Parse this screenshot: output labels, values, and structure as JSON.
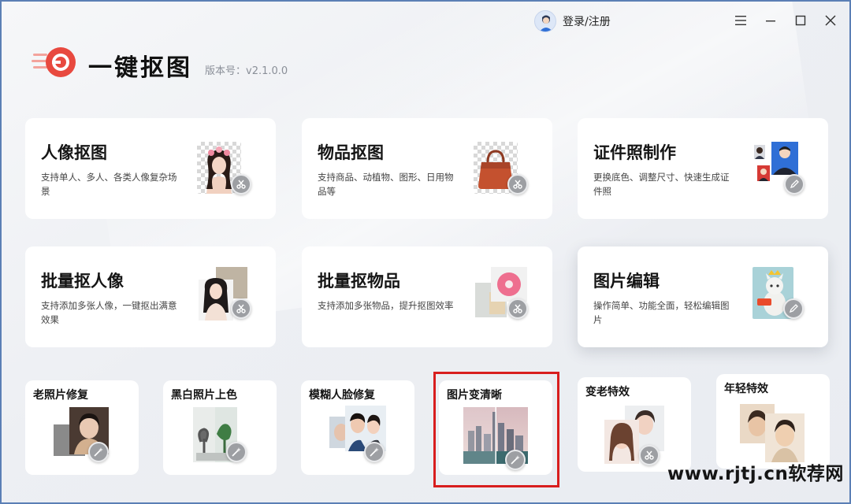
{
  "header": {
    "login_label": "登录/注册",
    "app_title": "一键抠图",
    "version": "版本号：v2.1.0.0"
  },
  "colors": {
    "accent_red": "#e8493f",
    "highlight_red": "#d81e1e",
    "window_border": "#5b7fb5"
  },
  "feature_cards": [
    {
      "title": "人像抠图",
      "desc": "支持单人、多人、各类人像复杂场景",
      "icon": "scissors-icon"
    },
    {
      "title": "物品抠图",
      "desc": "支持商品、动植物、图形、日用物品等",
      "icon": "scissors-icon"
    },
    {
      "title": "证件照制作",
      "desc": "更换底色、调整尺寸、快速生成证件照",
      "icon": "pencil-icon"
    },
    {
      "title": "批量抠人像",
      "desc": "支持添加多张人像，一键抠出满意效果",
      "icon": "scissors-icon"
    },
    {
      "title": "批量抠物品",
      "desc": "支持添加多张物品，提升抠图效率",
      "icon": "scissors-icon"
    },
    {
      "title": "图片编辑",
      "desc": "操作简单、功能全面，轻松编辑图片",
      "icon": "pencil-icon"
    }
  ],
  "tool_cards": [
    {
      "title": "老照片修复",
      "icon": "wand-icon"
    },
    {
      "title": "黑白照片上色",
      "icon": "wand-icon"
    },
    {
      "title": "模糊人脸修复",
      "icon": "wand-icon"
    },
    {
      "title": "图片变清晰",
      "icon": "wand-icon"
    },
    {
      "title": "变老特效",
      "icon": "scissors-icon"
    },
    {
      "title": "年轻特效",
      "icon": "scissors-icon"
    }
  ],
  "watermark": "www.rjtj.cn软荐网"
}
